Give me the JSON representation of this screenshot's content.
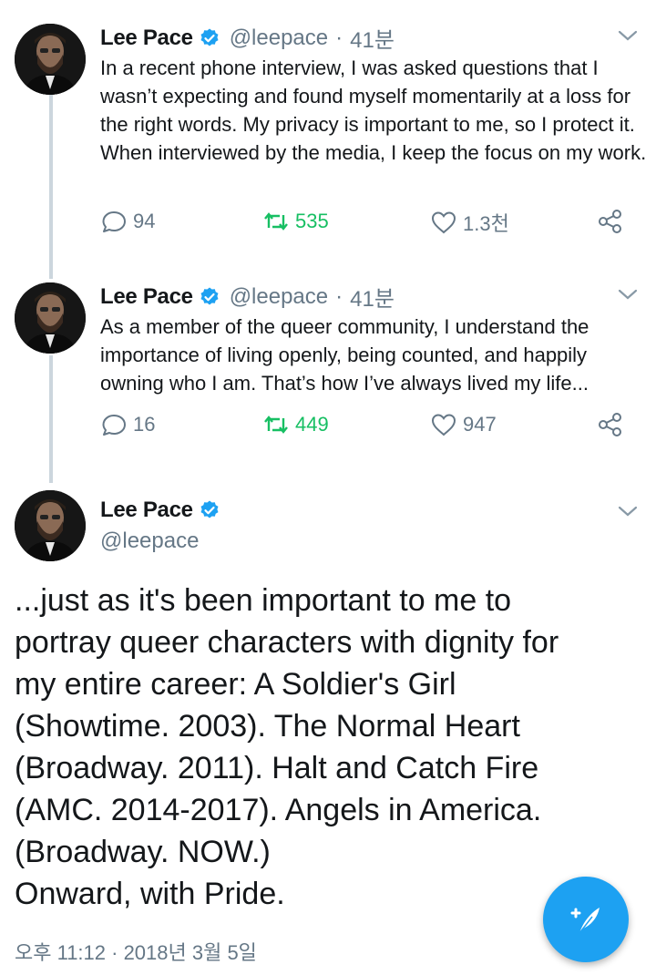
{
  "tweets": [
    {
      "name": "Lee Pace",
      "handle": "@leepace",
      "time": "41분",
      "text": "In a recent phone interview, I was asked questions that I wasn’t expecting and found myself momentarily at a loss for the right words. My privacy is important to me, so I protect it. When interviewed by the media, I keep the focus on my work.",
      "replies": "94",
      "retweets": "535",
      "likes": "1.3천"
    },
    {
      "name": "Lee Pace",
      "handle": "@leepace",
      "time": "41분",
      "text": "As a member of the queer community, I understand the importance of living openly, being counted, and happily owning who I am. That’s how I’ve always lived my life...",
      "replies": "16",
      "retweets": "449",
      "likes": "947"
    }
  ],
  "main_tweet": {
    "name": "Lee Pace",
    "handle": "@leepace",
    "lines": [
      "...just as it's been important to me to",
      "portray queer characters with dignity for",
      "my entire career: A Soldier's Girl",
      "(Showtime. 2003). The Normal Heart",
      "(Broadway. 2011). Halt and Catch Fire",
      "(AMC. 2014-2017). Angels in America.",
      "(Broadway. NOW.)",
      "Onward, with Pride."
    ],
    "timestamp": "오후 11:12 · 2018년 3월 5일"
  },
  "separator": "·",
  "colors": {
    "accent": "#1da1f2",
    "retweet": "#17bf63",
    "muted": "#657786",
    "thread_line": "#ccd6dd"
  },
  "icons": [
    "verified-badge-icon",
    "chevron-down-icon",
    "reply-icon",
    "retweet-icon",
    "like-icon",
    "share-icon",
    "compose-quill-icon"
  ]
}
